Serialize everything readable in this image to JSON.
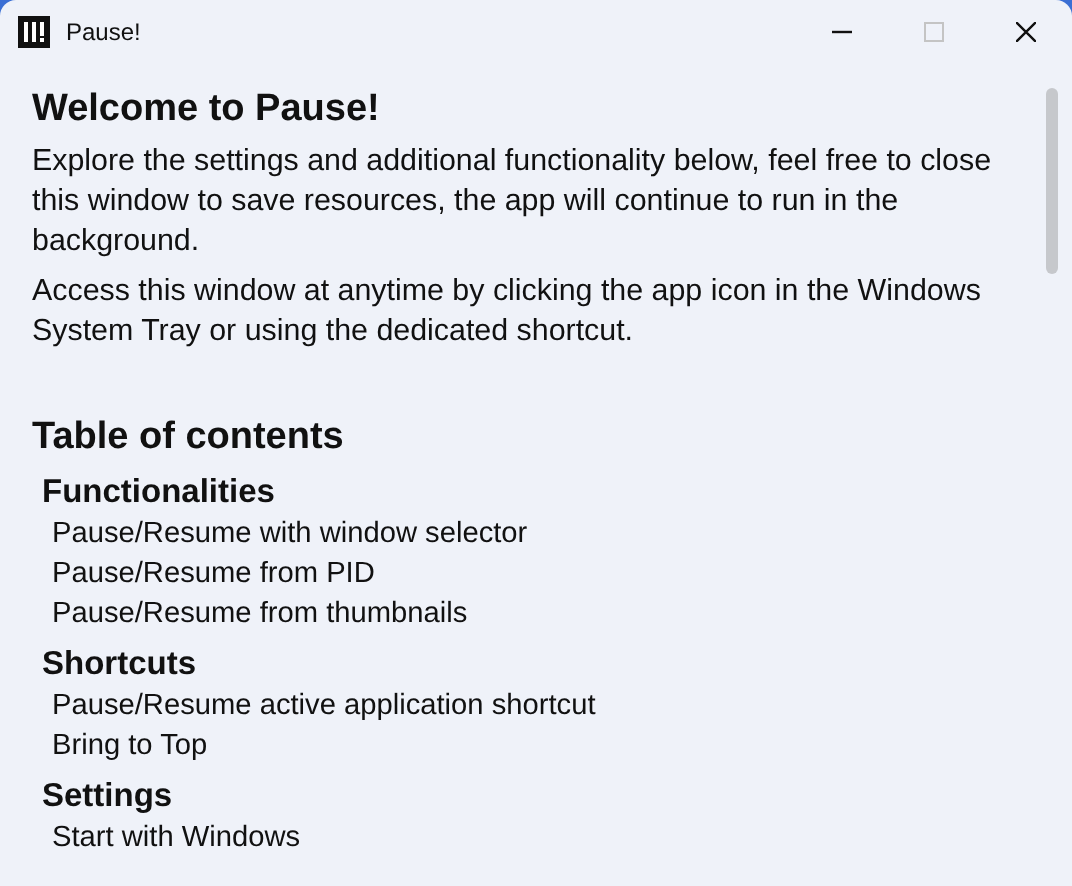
{
  "window": {
    "title": "Pause!",
    "controls": [
      {
        "kind": "minimize",
        "disabled": false
      },
      {
        "kind": "maximize",
        "disabled": true
      },
      {
        "kind": "close",
        "disabled": false
      }
    ]
  },
  "welcome": {
    "heading": "Welcome to Pause!",
    "paragraphs": [
      "Explore the settings and additional functionality below, feel free to close this window to save resources, the app will continue to run in the background.",
      "Access this window at anytime by clicking the app icon in the Windows System Tray or using the dedicated shortcut."
    ]
  },
  "toc": {
    "heading": "Table of contents",
    "sections": [
      {
        "title": "Functionalities",
        "items": [
          "Pause/Resume with window selector",
          "Pause/Resume from PID",
          "Pause/Resume from thumbnails"
        ]
      },
      {
        "title": "Shortcuts",
        "items": [
          "Pause/Resume active application shortcut",
          "Bring to Top"
        ]
      },
      {
        "title": "Settings",
        "items": [
          "Start with Windows"
        ]
      }
    ]
  }
}
